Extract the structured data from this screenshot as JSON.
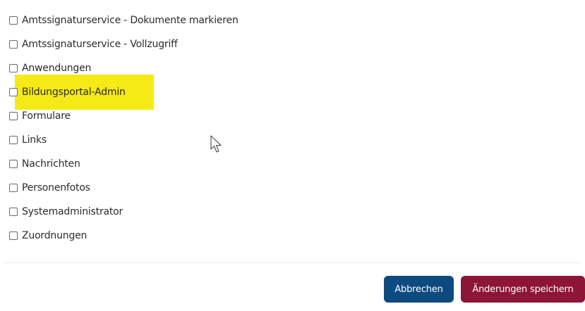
{
  "checkboxes": [
    {
      "label": "Amtssignaturservice - Dokumente markieren",
      "checked": false
    },
    {
      "label": "Amtssignaturservice - Vollzugriff",
      "checked": false
    },
    {
      "label": "Anwendungen",
      "checked": false
    },
    {
      "label": "Bildungsportal-Admin",
      "checked": false,
      "highlighted": true
    },
    {
      "label": "Formulare",
      "checked": false
    },
    {
      "label": "Links",
      "checked": false
    },
    {
      "label": "Nachrichten",
      "checked": false
    },
    {
      "label": "Personenfotos",
      "checked": false
    },
    {
      "label": "Systemadministrator",
      "checked": false
    },
    {
      "label": "Zuordnungen",
      "checked": false
    }
  ],
  "actions": {
    "cancel_label": "Abbrechen",
    "save_label": "Änderungen speichern"
  },
  "colors": {
    "highlight": "#f5ea16",
    "cancel_button": "#0d4a80",
    "save_button": "#8d1537"
  },
  "icons": {
    "cursor": "mouse-pointer-icon"
  }
}
